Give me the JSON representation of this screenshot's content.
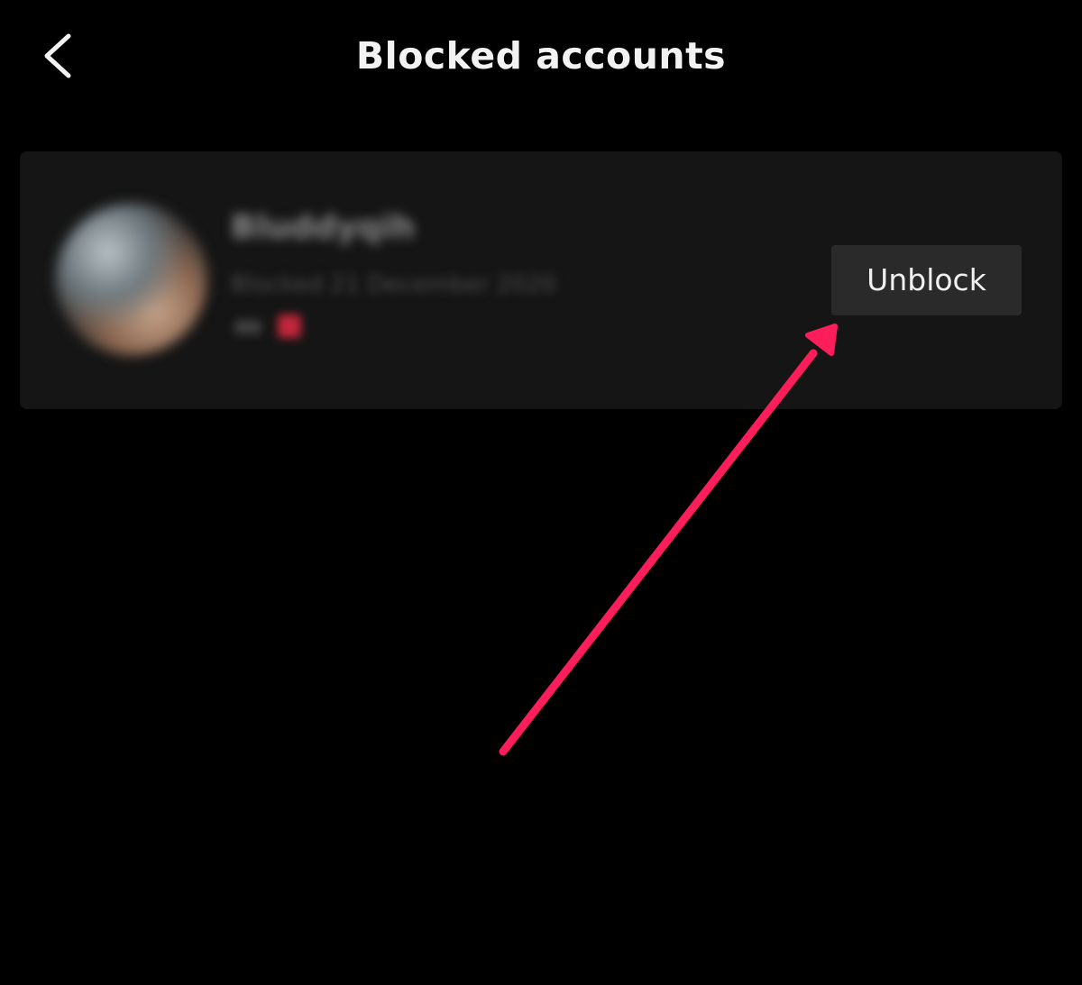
{
  "header": {
    "title": "Blocked accounts",
    "back_icon": "chevron-left-icon"
  },
  "blocked_list": [
    {
      "name_blurred": "Bluddyqih",
      "subtitle_blurred": "Blocked 21 December 2020",
      "tag_blurred": "Ys",
      "button_label": "Unblock"
    }
  ],
  "annotation": {
    "icon": "arrow-annotation",
    "color": "#fb1e5a"
  },
  "colors": {
    "background": "#000000",
    "card": "#151515",
    "button": "#2a2a2a",
    "text": "#f2f2f2"
  }
}
